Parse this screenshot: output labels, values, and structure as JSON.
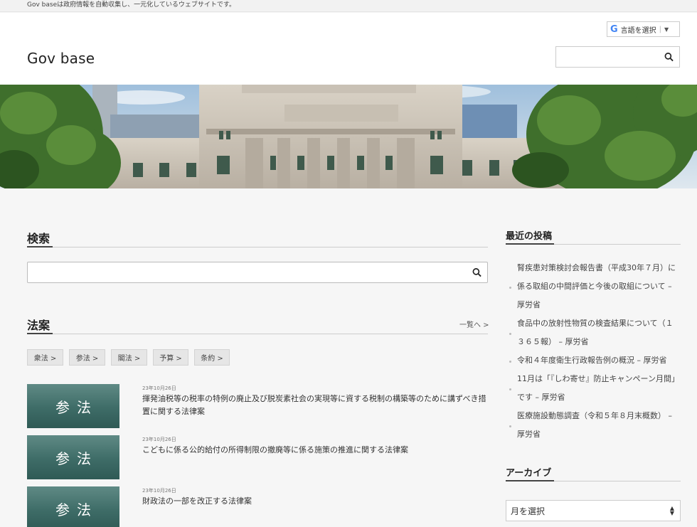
{
  "topbar": {
    "notice": "Gov baseは政府情報を自動収集し、一元化しているウェブサイトです。"
  },
  "header": {
    "site_title": "Gov base",
    "lang_select": {
      "g_mark": "G",
      "label": "言語を選択",
      "arrow": "▼"
    },
    "search": {
      "placeholder": ""
    }
  },
  "main": {
    "search_section": {
      "heading": "検索",
      "placeholder": ""
    },
    "bills_section": {
      "heading": "法案",
      "more_link": "一覧へ >",
      "categories": [
        "衆法 >",
        "参法 >",
        "閣法 >",
        "予算 >",
        "条約 >"
      ],
      "articles": [
        {
          "thumb_label": "参法",
          "date": "23年10月26日",
          "title": "揮発油税等の税率の特例の廃止及び脱炭素社会の実現等に資する税制の構築等のために講ずべき措置に関する法律案"
        },
        {
          "thumb_label": "参法",
          "date": "23年10月26日",
          "title": "こどもに係る公的給付の所得制限の撤廃等に係る施策の推進に関する法律案"
        },
        {
          "thumb_label": "参法",
          "date": "23年10月26日",
          "title": "財政法の一部を改正する法律案"
        }
      ]
    }
  },
  "sidebar": {
    "recent_heading": "最近の投稿",
    "recent_posts": [
      "腎疾患対策検討会報告書（平成30年７月）に係る取組の中間評価と今後の取組について – 厚労省",
      "食品中の放射性物質の検査結果について（１３６５報） – 厚労省",
      "令和４年度衛生行政報告例の概況 – 厚労省",
      "11月は「『しわ寄せ』防止キャンペーン月間」です – 厚労省",
      "医療施設動態調査（令和５年８月末概数） – 厚労省"
    ],
    "archive_heading": "アーカイブ",
    "archive_select": "月を選択"
  }
}
